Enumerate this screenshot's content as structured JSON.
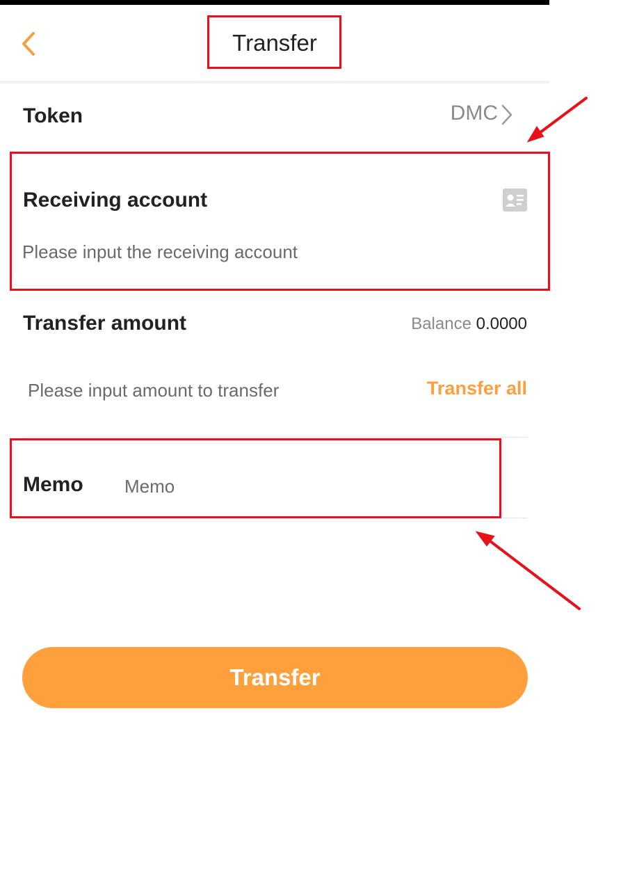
{
  "header": {
    "title": "Transfer",
    "back_icon": "chevron-left-icon"
  },
  "token_row": {
    "label": "Token",
    "value": "DMC",
    "chevron_icon": "chevron-right-icon"
  },
  "receiving": {
    "label": "Receiving account",
    "placeholder": "Please input the receiving account",
    "value": "",
    "contact_icon": "contact-card-icon"
  },
  "amount": {
    "label": "Transfer amount",
    "balance_label": "Balance",
    "balance_value": "0.0000",
    "placeholder": "Please input amount to transfer",
    "value": "",
    "transfer_all_label": "Transfer all"
  },
  "memo": {
    "label": "Memo",
    "placeholder": "Memo",
    "value": ""
  },
  "submit": {
    "label": "Transfer"
  },
  "colors": {
    "accent": "#ffa03d",
    "highlight": "#e8101a",
    "muted_text": "#8a8a8a"
  }
}
